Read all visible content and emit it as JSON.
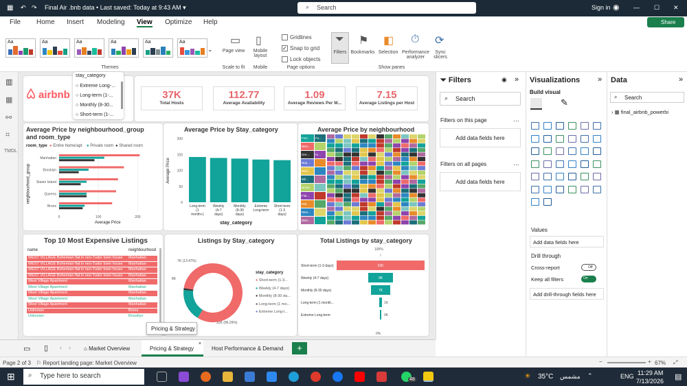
{
  "titlebar": {
    "title": "Final Air .bnb data • Last saved: Today at 9:43 AM ▾",
    "search": "Search",
    "signin": "Sign in"
  },
  "menu": [
    "File",
    "Home",
    "Insert",
    "Modeling",
    "View",
    "Optimize",
    "Help"
  ],
  "share": "Share",
  "ribbon": {
    "themes_label": "Themes",
    "page_view": "Page view",
    "scale_to_fit": "Scale to fit",
    "mobile_layout": "Mobile layout",
    "mobile": "Mobile",
    "gridlines": "Gridlines",
    "snap_to_grid": "Snap to grid",
    "lock_objects": "Lock objects",
    "page_options": "Page options",
    "filters": "Filters",
    "bookmarks": "Bookmarks",
    "selection": "Selection",
    "performance": "Performance analyzer",
    "sync": "Sync slicers",
    "show_panes": "Show panes"
  },
  "slicer": {
    "title": "stay_category",
    "items": [
      "Extreme Long-...",
      "Long-term (1-...",
      "Monthly (8-30...",
      "Short-term (1-..."
    ]
  },
  "logo": "airbnb",
  "kpis": [
    {
      "value": "37K",
      "label": "Total Hosts"
    },
    {
      "value": "112.77",
      "label": "Average Availability"
    },
    {
      "value": "1.09",
      "label": "Average Reviews Per M..."
    },
    {
      "value": "7.15",
      "label": "Average Listings per Host"
    }
  ],
  "chart1": {
    "title": "Average Price by neighbourhood_group and room_type",
    "legend_title": "room_type",
    "legend": [
      "Entire home/apt",
      "Private room",
      "Shared room"
    ],
    "ylabel": "neighbourhood_group",
    "xlabel": "Average Price",
    "xticks": [
      "0",
      "100",
      "200"
    ]
  },
  "chart2": {
    "title": "Average Price by Stay_category",
    "ylabel": "Average Price",
    "xlabel": "stay_category",
    "yticks": [
      "0",
      "50",
      "100",
      "150",
      "200"
    ]
  },
  "chart3": {
    "title": "Average Price by neighbourhood",
    "labels": [
      "Fort...",
      "Wes...",
      "Gre...",
      "Nep...",
      "Wes...",
      "Wil...",
      "NoHo",
      "Flat...",
      "Mid...",
      "Wes...",
      "Wes..."
    ],
    "labels2": [
      "Fo...",
      "Ki..."
    ]
  },
  "table": {
    "title": "Top 10 Most Expensive Listings",
    "col1": "name",
    "col2": "neighbourhood",
    "rows": [
      {
        "name": "WEST VILLAGE Bohemian flat in neo-Tudor town house",
        "hood": "Manhattan"
      },
      {
        "name": "WEST VILLAGE Bohemian flat in neo-Tudor town house",
        "hood": "Manhattan"
      },
      {
        "name": "WEST VILLAGE Bohemian flat in neo-Tudor town house",
        "hood": "Manhattan"
      },
      {
        "name": "WEST VILLAGE Bohemian flat in neo-Tudor town house",
        "hood": "Manhattan"
      },
      {
        "name": "West Village Apartment",
        "hood": "Manhattan"
      },
      {
        "name": "West Village Apartment",
        "hood": "Manhattan"
      },
      {
        "name": "West Village Apartment",
        "hood": "Manhattan"
      },
      {
        "name": "West Village Apartment",
        "hood": "Manhattan"
      },
      {
        "name": "West Village Apartment",
        "hood": "Manhattan"
      },
      {
        "name": "Unknown",
        "hood": "Bronx"
      },
      {
        "name": "Unknown",
        "hood": "Brooklyn"
      }
    ]
  },
  "chart5": {
    "title": "Listings by Stay_category",
    "legend_title": "stay_category",
    "legend": [
      "Short-term (1-3...",
      "Weekly (4-7 days)",
      "Monthly (8-30 da...",
      "Long-term (1 mo...",
      "Extreme Long-l..."
    ],
    "label_small": "7K (13.47%)",
    "label_small2": "8K",
    "label_big": "32K (86.29%)"
  },
  "chart6": {
    "title": "Total Listings by stay_category",
    "top": "100%",
    "bottom": "0%"
  },
  "tooltip": "Pricing & Strategy",
  "filters": {
    "title": "Filters",
    "search": "Search",
    "on_page": "Filters on this page",
    "on_all": "Filters on all pages",
    "add": "Add data fields here"
  },
  "viz": {
    "title": "Visualizations",
    "build": "Build visual",
    "values": "Values",
    "add": "Add data fields here",
    "drill": "Drill through",
    "cross": "Cross-report",
    "cross_state": "Off",
    "keep": "Keep all filters",
    "keep_state": "On",
    "add_drill": "Add drill-through fields here"
  },
  "data": {
    "title": "Data",
    "search": "Search",
    "table": "final_airbnb_powerbi"
  },
  "tabs": [
    "Market Overview",
    "Pricing & Strategy",
    "Host Performance & Demand"
  ],
  "status": {
    "page": "Page 2 of 3",
    "landing": "Report landing page: Market Overview",
    "zoom": "67%"
  },
  "taskbar": {
    "search": "Type here to search",
    "temp": "35°C",
    "weather": "مشمس",
    "lang": "ENG",
    "time": "11:29 AM",
    "date": "7/13/2026",
    "badge": "48"
  },
  "chart_data": [
    {
      "type": "bar",
      "title": "Average Price by neighbourhood_group and room_type",
      "categories": [
        "Manhattan",
        "Brooklyn",
        "Staten Island",
        "Queens",
        "Bronx"
      ],
      "series": [
        {
          "name": "Entire home/apt",
          "values": [
            205,
            165,
            150,
            145,
            135
          ]
        },
        {
          "name": "Private room",
          "values": [
            115,
            75,
            70,
            70,
            65
          ]
        },
        {
          "name": "Shared room",
          "values": [
            90,
            50,
            55,
            70,
            60
          ]
        }
      ],
      "xlim": [
        0,
        250
      ]
    },
    {
      "type": "bar",
      "title": "Average Price by Stay_category",
      "categories": [
        "Long-term (1 month+)",
        "Weekly (4-7 days)",
        "Monthly (8-30 days)",
        "Extreme Long-term",
        "Short-term (1-3 days)"
      ],
      "values": [
        142,
        139,
        137,
        134,
        132
      ],
      "ylim": [
        0,
        200
      ]
    },
    {
      "type": "pie",
      "title": "Listings by Stay_category",
      "values": [
        32,
        7,
        0.4
      ],
      "labels": [
        "32K (86.29%)",
        "7K (13.47%)",
        "8K"
      ]
    },
    {
      "type": "bar",
      "title": "Total Listings by stay_category",
      "categories": [
        "Short-term (1-3 days)",
        "Weekly (4-7 days)",
        "Monthly (8-30 days)",
        "Long-term (1 month...",
        "Extreme Long-term"
      ],
      "values": [
        32,
        9,
        7,
        1,
        0
      ],
      "value_labels": [
        "32K",
        "9K",
        "7K",
        "1K",
        "0K"
      ]
    }
  ]
}
